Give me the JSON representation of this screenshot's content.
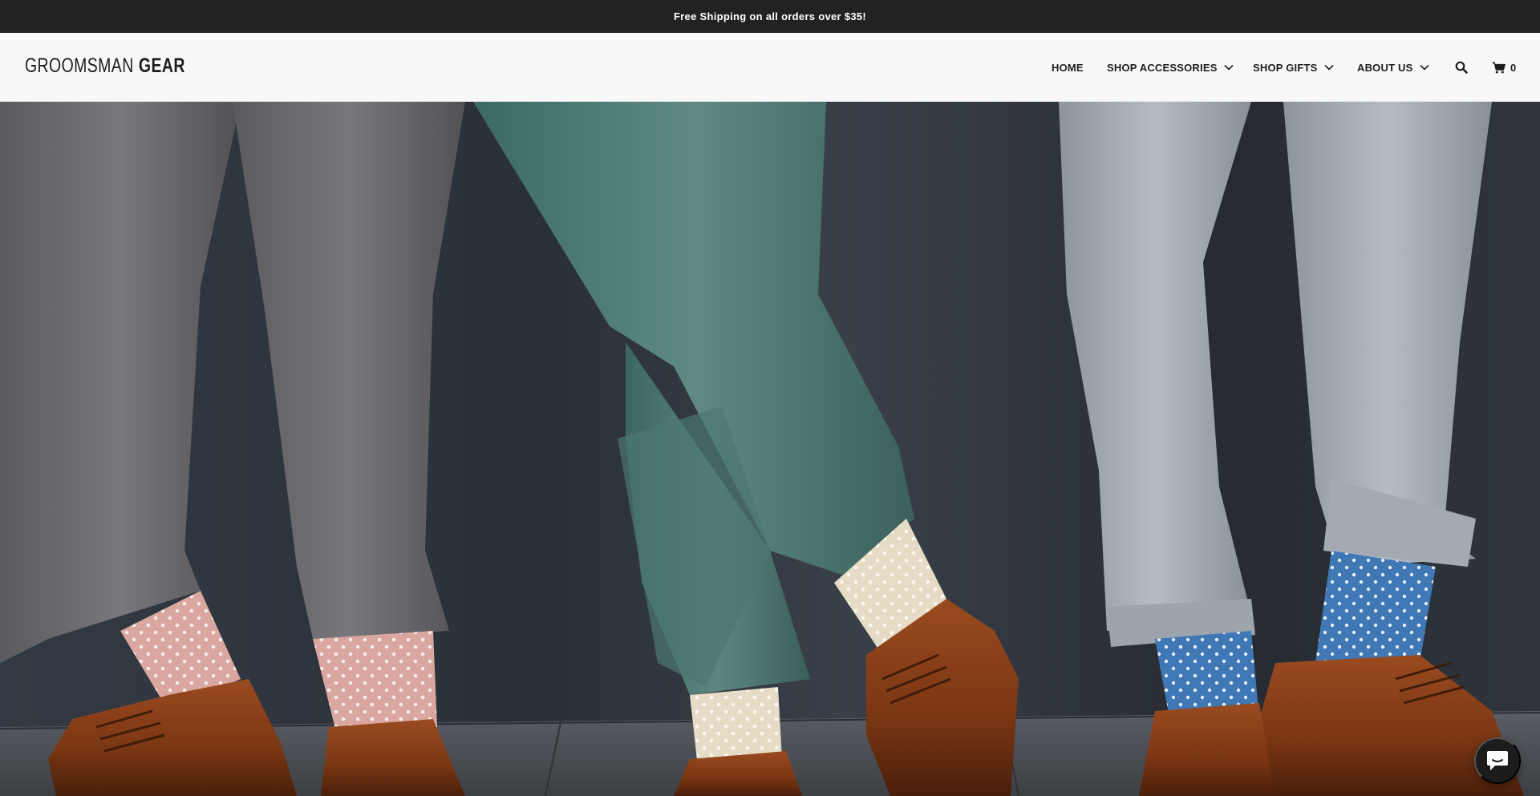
{
  "announcement": {
    "text": "Free Shipping on all orders over $35!"
  },
  "header": {
    "logo_light": "GROOMSMAN",
    "logo_bold": "GEAR",
    "nav": [
      {
        "label": "HOME",
        "has_dropdown": false
      },
      {
        "label": "SHOP ACCESSORIES",
        "has_dropdown": true
      },
      {
        "label": "SHOP GIFTS",
        "has_dropdown": true
      },
      {
        "label": "ABOUT US",
        "has_dropdown": true
      }
    ],
    "search_icon": "search-icon",
    "cart_icon": "shopping-cart-icon",
    "cart_count": "0"
  },
  "hero": {
    "image": "three men's legs in trousers with colorful polka-dot socks and brown leather dress shoes against a dark wall"
  },
  "chat": {
    "icon": "chat-bubble-icon"
  },
  "colors": {
    "announcement_bg": "#222222",
    "announcement_text": "#ffffff",
    "header_bg": "#f8f8f8",
    "text": "#1d1d1d"
  }
}
